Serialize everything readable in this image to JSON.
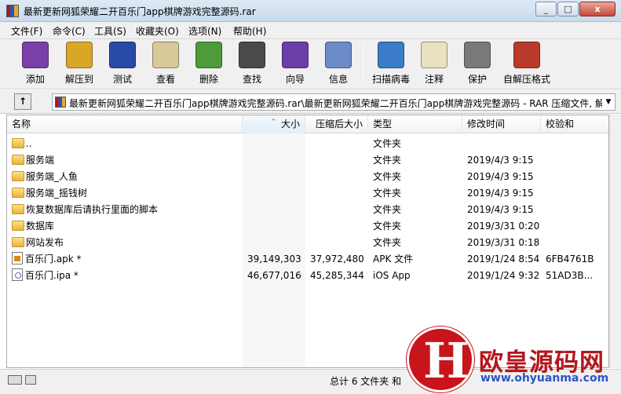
{
  "window": {
    "title": "最新更新网狐荣耀二开百乐门app棋牌游戏完整源码.rar",
    "minimize_label": "_",
    "maximize_label": "□",
    "close_label": "x"
  },
  "menu": [
    {
      "label": "文件(F)"
    },
    {
      "label": "命令(C)"
    },
    {
      "label": "工具(S)"
    },
    {
      "label": "收藏夹(O)"
    },
    {
      "label": "选项(N)"
    },
    {
      "label": "帮助(H)"
    }
  ],
  "toolbar": [
    {
      "label": "添加",
      "icon": "add-archive-icon",
      "color": "#7a3fa8"
    },
    {
      "label": "解压到",
      "icon": "extract-to-icon",
      "color": "#d9a628"
    },
    {
      "label": "测试",
      "icon": "test-icon",
      "color": "#2a4aa8"
    },
    {
      "label": "查看",
      "icon": "view-icon",
      "color": "#d9c89a"
    },
    {
      "label": "删除",
      "icon": "delete-icon",
      "color": "#4f9a3b"
    },
    {
      "label": "查找",
      "icon": "find-icon",
      "color": "#4a4a4a"
    },
    {
      "label": "向导",
      "icon": "wizard-icon",
      "color": "#6b3fa8"
    },
    {
      "label": "信息",
      "icon": "info-icon",
      "color": "#6c8cc8"
    },
    {
      "label": "扫描病毒",
      "icon": "virus-scan-icon",
      "color": "#3a7cc8"
    },
    {
      "label": "注释",
      "icon": "comment-icon",
      "color": "#e8e2c0"
    },
    {
      "label": "保护",
      "icon": "protect-icon",
      "color": "#7a7a7a"
    },
    {
      "label": "自解压格式",
      "icon": "sfx-icon",
      "color": "#b83a2a"
    }
  ],
  "path": {
    "up_label": "↑",
    "text": "最新更新网狐荣耀二开百乐门app棋牌游戏完整源码.rar\\最新更新网狐荣耀二开百乐门app棋牌游戏完整源码 - RAR 压缩文件, 解"
  },
  "columns": {
    "name": "名称",
    "size": "大小",
    "packed": "压缩后大小",
    "type": "类型",
    "modified": "修改时间",
    "crc": "校验和"
  },
  "files": [
    {
      "name": "..",
      "size": "",
      "packed": "",
      "type": "文件夹",
      "modified": "",
      "crc": "",
      "icon": "folder-icon"
    },
    {
      "name": "服务端",
      "size": "",
      "packed": "",
      "type": "文件夹",
      "modified": "2019/4/3 9:15",
      "crc": "",
      "icon": "folder-icon"
    },
    {
      "name": "服务端_人鱼",
      "size": "",
      "packed": "",
      "type": "文件夹",
      "modified": "2019/4/3 9:15",
      "crc": "",
      "icon": "folder-icon"
    },
    {
      "name": "服务端_摇钱树",
      "size": "",
      "packed": "",
      "type": "文件夹",
      "modified": "2019/4/3 9:15",
      "crc": "",
      "icon": "folder-icon"
    },
    {
      "name": "恢复数据库后请执行里面的脚本",
      "size": "",
      "packed": "",
      "type": "文件夹",
      "modified": "2019/4/3 9:15",
      "crc": "",
      "icon": "folder-icon"
    },
    {
      "name": "数据库",
      "size": "",
      "packed": "",
      "type": "文件夹",
      "modified": "2019/3/31 0:20",
      "crc": "",
      "icon": "folder-icon"
    },
    {
      "name": "网站发布",
      "size": "",
      "packed": "",
      "type": "文件夹",
      "modified": "2019/3/31 0:18",
      "crc": "",
      "icon": "folder-icon"
    },
    {
      "name": "百乐门.apk *",
      "size": "39,149,303",
      "packed": "37,972,480",
      "type": "APK 文件",
      "modified": "2019/1/24 8:54",
      "crc": "6FB4761B",
      "icon": "apk-file-icon"
    },
    {
      "name": "百乐门.ipa *",
      "size": "46,677,016",
      "packed": "45,285,344",
      "type": "iOS App",
      "modified": "2019/1/24 9:32",
      "crc": "51AD3B...",
      "icon": "ipa-file-icon"
    }
  ],
  "status": {
    "text": "总计 6 文件夹 和"
  },
  "watermark": {
    "logo_letter": "H",
    "name": "欧皇源码网",
    "url": "www.ohyuanma.com"
  }
}
